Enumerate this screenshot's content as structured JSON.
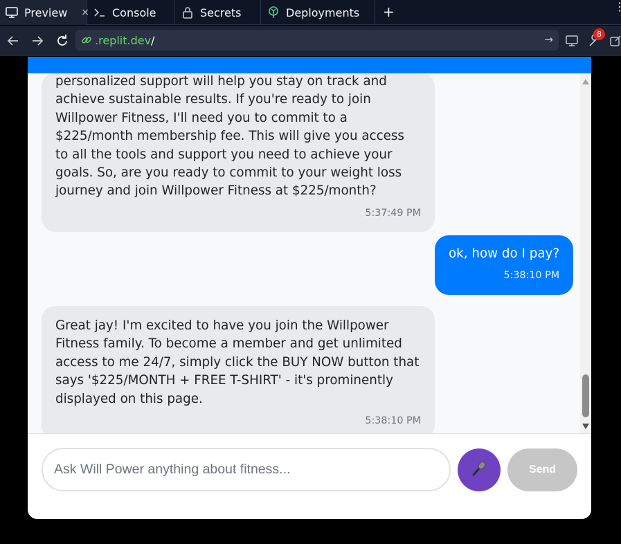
{
  "tabs": [
    {
      "label": "Preview",
      "icon": "monitor-icon",
      "close": "×"
    },
    {
      "label": "Console",
      "icon": "terminal-icon"
    },
    {
      "label": "Secrets",
      "icon": "lock-icon"
    },
    {
      "label": "Deployments",
      "icon": "deployments-icon"
    }
  ],
  "tabbar": {
    "new_tab": "+",
    "menu": "⋮"
  },
  "url": {
    "host": ".replit.dev",
    "path": "/"
  },
  "toolbar": {
    "badge_count": "8"
  },
  "messages": [
    {
      "role": "bot",
      "text": "personalized support will help you stay on track and achieve sustainable results. If you're ready to join Willpower Fitness, I'll need you to commit to a $225/month membership fee. This will give you access to all the tools and support you need to achieve your goals. So, are you ready to commit to your weight loss journey and join Willpower Fitness at $225/month?",
      "time": "5:37:49 PM"
    },
    {
      "role": "user",
      "text": "ok, how do I pay?",
      "time": "5:38:10 PM"
    },
    {
      "role": "bot",
      "text": "Great jay! I'm excited to have you join the Willpower Fitness family. To become a member and get unlimited access to me 24/7, simply click the BUY NOW button that says '$225/MONTH + FREE T-SHIRT' - it's prominently displayed on this page.",
      "time": "5:38:10 PM"
    }
  ],
  "input": {
    "placeholder": "Ask Will Power anything about fitness..."
  },
  "send_label": "Send",
  "colors": {
    "header": "#007bff",
    "user_bubble": "#007bff",
    "bot_bubble": "#e8eaed",
    "mic": "#6f42c1",
    "send_disabled": "#c6c6c6"
  }
}
